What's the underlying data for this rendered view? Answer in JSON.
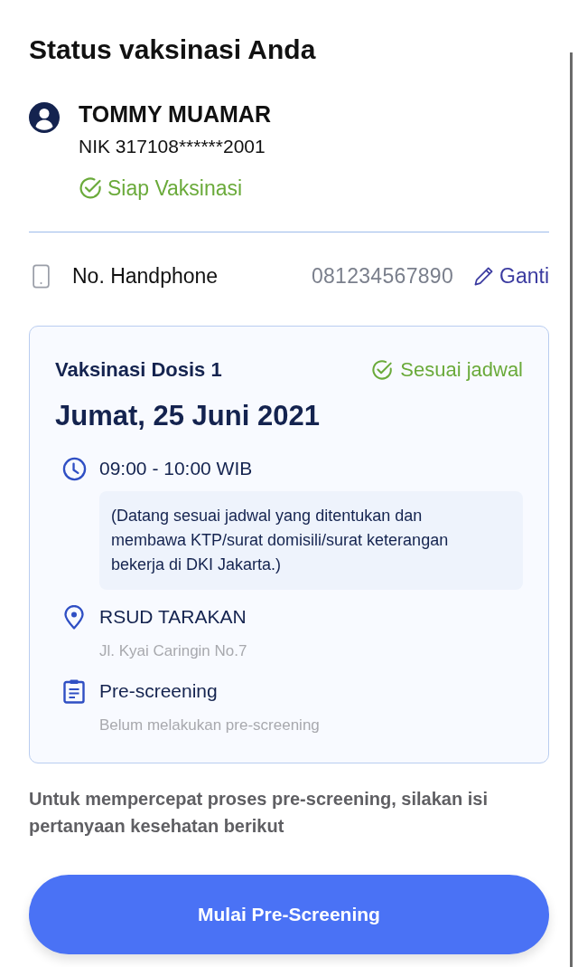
{
  "header": {
    "title": "Status vaksinasi Anda"
  },
  "profile": {
    "name": "TOMMY MUAMAR",
    "nik": "NIK 317108******2001",
    "status": "Siap Vaksinasi"
  },
  "phone": {
    "label": "No. Handphone",
    "value": "081234567890",
    "action": "Ganti"
  },
  "schedule": {
    "dose": "Vaksinasi Dosis 1",
    "status": "Sesuai jadwal",
    "date": "Jumat, 25 Juni 2021",
    "details": [
      {
        "kind": "time",
        "title": "09:00 - 10:00 WIB",
        "note": "(Datang sesuai jadwal yang ditentukan dan membawa KTP/surat domisili/surat keterangan bekerja di DKI Jakarta.)"
      },
      {
        "kind": "location",
        "title": "RSUD TARAKAN",
        "subtitle": "Jl. Kyai Caringin No.7"
      },
      {
        "kind": "prescreening",
        "title": "Pre-screening",
        "subtitle": "Belum melakukan pre-screening"
      }
    ]
  },
  "prompt": "Untuk mempercepat proses pre-screening, silakan isi pertanyaan kesehatan berikut",
  "primary_button": "Mulai Pre-Screening"
}
